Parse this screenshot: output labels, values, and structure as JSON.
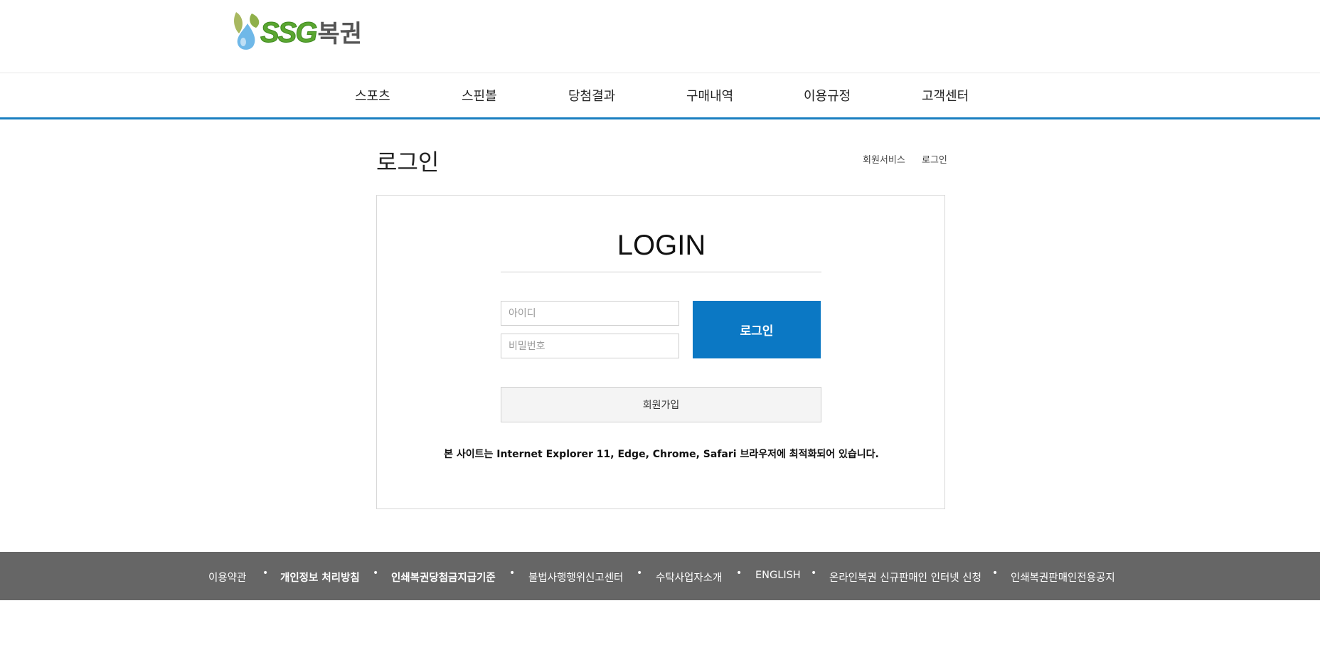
{
  "brand": {
    "logo_latin": "SSG",
    "logo_korean": "복권",
    "logo_green": "#5aa630",
    "logo_blue": "#6fb8e8",
    "logo_olive": "#a8b860"
  },
  "nav": {
    "items": [
      {
        "label": "스포츠"
      },
      {
        "label": "스핀볼"
      },
      {
        "label": "당첨결과"
      },
      {
        "label": "구매내역"
      },
      {
        "label": "이용규정"
      },
      {
        "label": "고객센터"
      }
    ],
    "accent_color": "#1a7fc0"
  },
  "page": {
    "title": "로그인",
    "breadcrumb": [
      "회원서비스",
      "로그인"
    ]
  },
  "login": {
    "heading": "LOGIN",
    "id_placeholder": "아이디",
    "pw_placeholder": "비밀번호",
    "submit_label": "로그인",
    "submit_color": "#0b78c4",
    "join_label": "회원가입",
    "notice": "본 사이트는 Internet Explorer 11, Edge, Chrome, Safari 브라우저에 최적화되어 있습니다."
  },
  "footer": {
    "background": "#666666",
    "links": [
      {
        "label": "이용약관",
        "bold": false
      },
      {
        "label": "개인정보 처리방침",
        "bold": true
      },
      {
        "label": "인쇄복권당첨금지급기준",
        "bold": true
      },
      {
        "label": "불법사행행위신고센터",
        "bold": false
      },
      {
        "label": "수탁사업자소개",
        "bold": false
      },
      {
        "label": "ENGLISH",
        "bold": false
      },
      {
        "label": "온라인복권 신규판매인 인터넷 신청",
        "bold": false
      },
      {
        "label": "인쇄복권판매인전용공지",
        "bold": false
      }
    ]
  }
}
